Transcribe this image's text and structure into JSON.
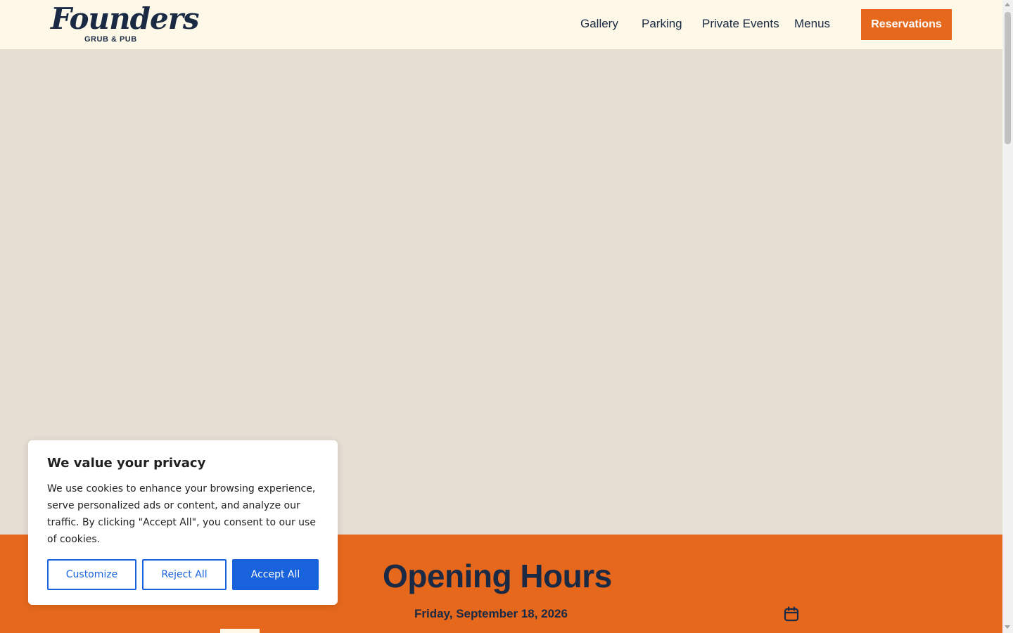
{
  "header": {
    "logo_script": "Founders",
    "logo_sub": "GRUB & PUB",
    "nav": [
      "Gallery",
      "Parking",
      "Private Events",
      "Menus"
    ],
    "reserve_label": "Reservations"
  },
  "hours": {
    "title": "Opening Hours",
    "date": "Friday, September 18, 2026"
  },
  "cookie": {
    "title": "We value your privacy",
    "text": "We use cookies to enhance your browsing experience, serve personalized ads or content, and analyze our traffic. By clicking \"Accept All\", you consent to our use of cookies.",
    "customize_label": "Customize",
    "reject_label": "Reject All",
    "accept_label": "Accept All"
  },
  "colors": {
    "brand_navy": "#1b2a44",
    "brand_orange": "#e5681c",
    "cream": "#fdf8e7",
    "consent_blue": "#1863dc"
  },
  "icons": {
    "calendar": "calendar-icon"
  }
}
